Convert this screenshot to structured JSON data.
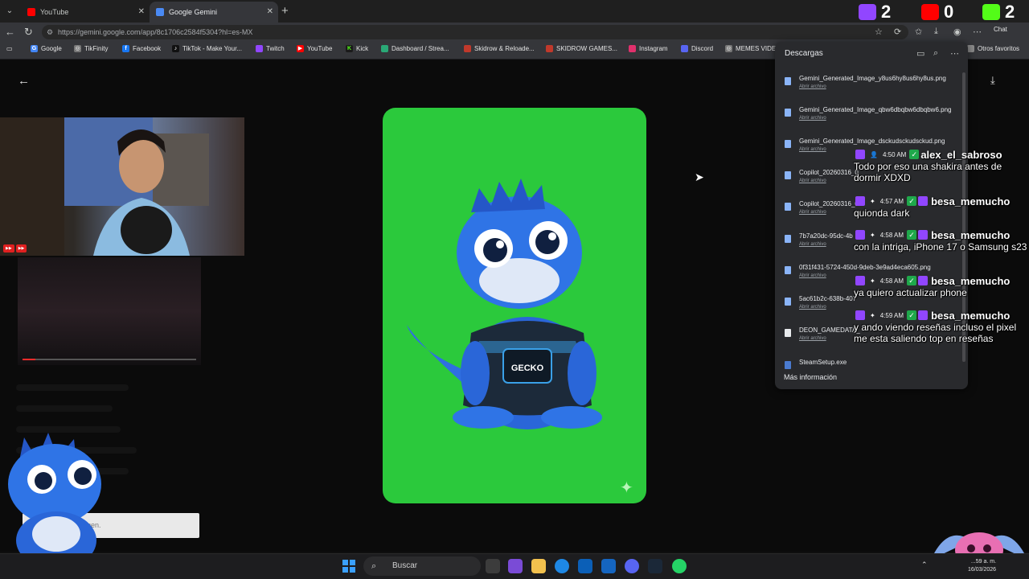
{
  "browser": {
    "tabs": [
      {
        "label": "YouTube",
        "active": false,
        "favicon_color": "#ff0000"
      },
      {
        "label": "Google Gemini",
        "active": true,
        "favicon_color": "#4a8af4"
      }
    ],
    "url": "https://gemini.google.com/app/8c1706c2584f5304?hl=es-MX",
    "chat_label": "Chat"
  },
  "bookmarks": [
    {
      "label": "Google",
      "icon": "google-icon",
      "color": "#4285f4"
    },
    {
      "label": "TikFinity",
      "icon": "globe-icon",
      "color": "#777777"
    },
    {
      "label": "Facebook",
      "icon": "facebook-icon",
      "color": "#1877f2"
    },
    {
      "label": "TikTok - Make Your...",
      "icon": "tiktok-icon",
      "color": "#111111"
    },
    {
      "label": "Twitch",
      "icon": "twitch-icon",
      "color": "#9146ff"
    },
    {
      "label": "YouTube",
      "icon": "youtube-icon",
      "color": "#ff0000"
    },
    {
      "label": "Kick",
      "icon": "kick-icon",
      "color": "#53fc18"
    },
    {
      "label": "Dashboard / Strea...",
      "icon": "dashboard-icon",
      "color": "#2aa876"
    },
    {
      "label": "Skidrow & Reloade...",
      "icon": "skidrow-icon",
      "color": "#c0392b"
    },
    {
      "label": "SKIDROW GAMES...",
      "icon": "skidrow-icon",
      "color": "#c0392b"
    },
    {
      "label": "Instagram",
      "icon": "instagram-icon",
      "color": "#e1306c"
    },
    {
      "label": "Discord",
      "icon": "discord-icon",
      "color": "#5865f2"
    },
    {
      "label": "MEMES VIDE",
      "icon": "globe-icon",
      "color": "#777777"
    },
    {
      "label": "Otros favoritos",
      "icon": "folder-icon",
      "color": "#c4c7c5"
    }
  ],
  "stream_counters": [
    {
      "platform": "twitch",
      "value": "2",
      "color": "#9146ff"
    },
    {
      "platform": "youtube",
      "value": "0",
      "color": "#ff0000"
    },
    {
      "platform": "kick",
      "value": "2",
      "color": "#53fc18"
    }
  ],
  "downloads": {
    "title": "Descargas",
    "open_label": "Abrir archivo",
    "more_label": "Más información",
    "items": [
      {
        "name": "Gemini_Generated_Image_y8us6hy8us6hy8us.png"
      },
      {
        "name": "Gemini_Generated_Image_qbw6dbqbw6dbqbw6.png"
      },
      {
        "name": "Gemini_Generated_Image_dsckudsckudsckud.png"
      },
      {
        "name": "Copilot_20260316_0"
      },
      {
        "name": "Copilot_20260316_0"
      },
      {
        "name": "7b7a20dc-95dc-4b"
      },
      {
        "name": "0f31f431-5724-450d-9deb-3e9ad4eca605.png"
      },
      {
        "name": "5ac61b2c-638b-407"
      },
      {
        "name": "DEON_GAMEDATA_"
      },
      {
        "name": "SteamSetup.exe"
      }
    ]
  },
  "chat": [
    {
      "time": "4:50 AM",
      "user": "alex_el_sabroso",
      "text": "Todo por eso una shakira antes de dormir XDXD"
    },
    {
      "time": "4:57 AM",
      "user": "besa_memucho",
      "text": "quionda dark"
    },
    {
      "time": "4:58 AM",
      "user": "besa_memucho",
      "text": "con la intriga, iPhone 17 o Samsung s23"
    },
    {
      "time": "4:58 AM",
      "user": "besa_memucho",
      "text": "ya quiero actualizar phone"
    },
    {
      "time": "4:59 AM",
      "user": "besa_memucho",
      "text": "y ando viendo reseñas incluso el pixel me esta saliendo top en reseñas"
    }
  ],
  "page": {
    "input_placeholder": "gen."
  },
  "taskbar": {
    "search_label": "Buscar",
    "clock_time": "...59 a. m.",
    "clock_date": "16/03/2026"
  }
}
